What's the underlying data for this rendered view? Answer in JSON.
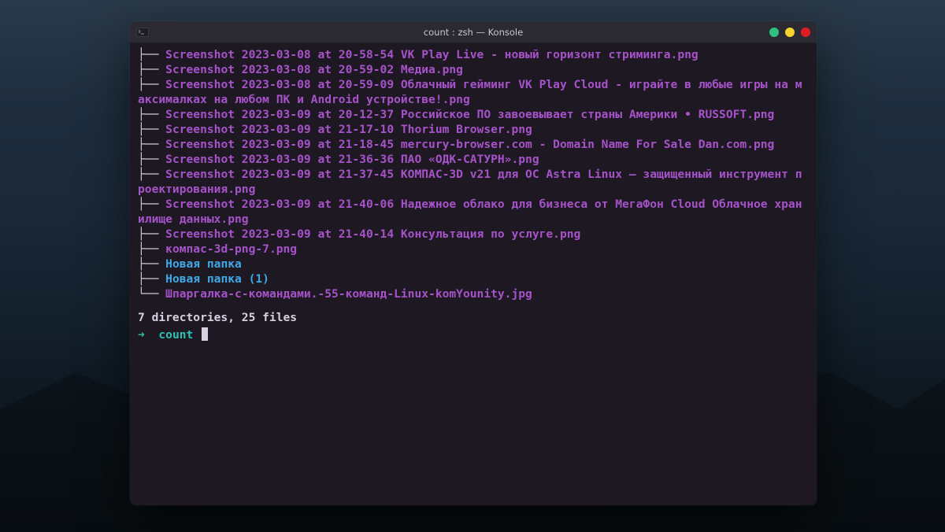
{
  "window": {
    "title": "count : zsh — Konsole"
  },
  "tree": [
    {
      "prefix": "├── ",
      "color": "purple",
      "name": "Screenshot 2023-03-08 at 20-58-54 VK Play Live - новый горизонт стриминга.png"
    },
    {
      "prefix": "├── ",
      "color": "purple",
      "name": "Screenshot 2023-03-08 at 20-59-02 Медиа.png"
    },
    {
      "prefix": "├── ",
      "color": "purple",
      "name": "Screenshot 2023-03-08 at 20-59-09 Облачный гейминг VK Play Cloud - играйте в любые игры на максималках на любом ПК и Android устройстве!.png"
    },
    {
      "prefix": "├── ",
      "color": "purple",
      "name": "Screenshot 2023-03-09 at 20-12-37 Российское ПО завоевывает страны Америки • RUSSOFT.png"
    },
    {
      "prefix": "├── ",
      "color": "purple",
      "name": "Screenshot 2023-03-09 at 21-17-10 Thorium Browser.png"
    },
    {
      "prefix": "├── ",
      "color": "purple",
      "name": "Screenshot 2023-03-09 at 21-18-45 mercury-browser.com - Domain Name For Sale Dan.com.png"
    },
    {
      "prefix": "├── ",
      "color": "purple",
      "name": "Screenshot 2023-03-09 at 21-36-36 ПАО «ОДК-САТУРН».png"
    },
    {
      "prefix": "├── ",
      "color": "purple",
      "name": "Screenshot 2023-03-09 at 21-37-45 КОМПАС-3D v21 для ОС Astra Linux — защищенный инструмент проектирования.png"
    },
    {
      "prefix": "├── ",
      "color": "purple",
      "name": "Screenshot 2023-03-09 at 21-40-06 Надежное облако для бизнеса от МегаФон Cloud Облачное хранилище данных.png"
    },
    {
      "prefix": "├── ",
      "color": "purple",
      "name": "Screenshot 2023-03-09 at 21-40-14 Консультация по услуге.png"
    },
    {
      "prefix": "├── ",
      "color": "purple",
      "name": "компас-3d-png-7.png"
    },
    {
      "prefix": "├── ",
      "color": "blue",
      "name": "Новая папка"
    },
    {
      "prefix": "├── ",
      "color": "blue",
      "name": "Новая папка (1)"
    },
    {
      "prefix": "└── ",
      "color": "purple",
      "name": "Шпаргалка-с-командами.-55-команд-Linux-komYounity.jpg"
    }
  ],
  "summary": "7 directories, 25 files",
  "prompt": {
    "arrow": "➜",
    "dir": "count"
  }
}
